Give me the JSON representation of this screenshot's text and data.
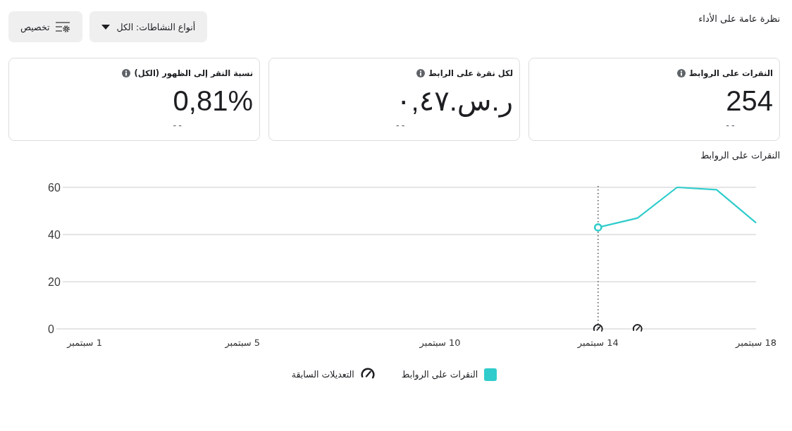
{
  "header": {
    "title": "نظرة عامة على الأداء",
    "buttons": [
      {
        "kind": "dropdown",
        "label": "أنواع النشاطات: الكل"
      },
      {
        "kind": "customize",
        "label": "تخصيص"
      }
    ]
  },
  "metrics": [
    {
      "title": "النقرات على الروابط",
      "value": "254",
      "comparison": "--"
    },
    {
      "title": "لكل نقرة على الرابط",
      "value": "ر.س.٠,٤٧",
      "comparison": "--"
    },
    {
      "title": "نسبة النقر إلى الظهور (الكل)",
      "value": "0,81%",
      "comparison": "--"
    }
  ],
  "chart": {
    "chart_data": {
      "type": "line",
      "title": "النقرات على الروابط",
      "x": [
        14,
        15,
        16,
        17,
        18
      ],
      "series": [
        {
          "name": "النقرات على الروابط",
          "type": "line",
          "color": "#30cccc",
          "values": [
            43,
            47,
            60,
            59,
            45
          ]
        },
        {
          "name": "التعديلات السابقة",
          "type": "scatter",
          "color": "#1c1e21",
          "values": [
            0,
            0,
            null,
            null,
            null
          ]
        }
      ],
      "xlim": [
        0.3,
        18
      ],
      "ylim": [
        0,
        60
      ],
      "xticks": [
        {
          "value": 1,
          "label": "1 سبتمبر"
        },
        {
          "value": 5,
          "label": "5 سبتمبر"
        },
        {
          "value": 10,
          "label": "10 سبتمبر"
        },
        {
          "value": 14,
          "label": "14 سبتمبر"
        },
        {
          "value": 18,
          "label": "18 سبتمبر"
        }
      ],
      "yticks": [
        0,
        20,
        40,
        60
      ],
      "ref_lines": [
        {
          "axis": "x",
          "value": 14
        }
      ]
    }
  }
}
